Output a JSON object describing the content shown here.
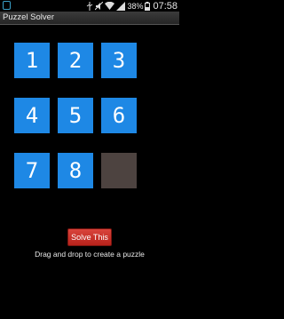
{
  "status_bar": {
    "battery": "38%",
    "time": "07:58",
    "icons": [
      "app-icon",
      "usb-icon",
      "mute-icon",
      "wifi-icon",
      "signal-icon",
      "battery-icon"
    ]
  },
  "title_bar": {
    "title": "Puzzel Solver"
  },
  "tiles": [
    {
      "label": "1",
      "color": "#1e88e5"
    },
    {
      "label": "2",
      "color": "#1e88e5"
    },
    {
      "label": "3",
      "color": "#1e88e5"
    },
    {
      "label": "4",
      "color": "#1e88e5"
    },
    {
      "label": "5",
      "color": "#1e88e5"
    },
    {
      "label": "6",
      "color": "#1e88e5"
    },
    {
      "label": "7",
      "color": "#1e88e5"
    },
    {
      "label": "8",
      "color": "#1e88e5"
    },
    {
      "label": "",
      "color": "#4d4340"
    }
  ],
  "solve_button": {
    "label": "Solve This",
    "color": "#c8302a"
  },
  "hint": "Drag and drop to create a puzzle"
}
